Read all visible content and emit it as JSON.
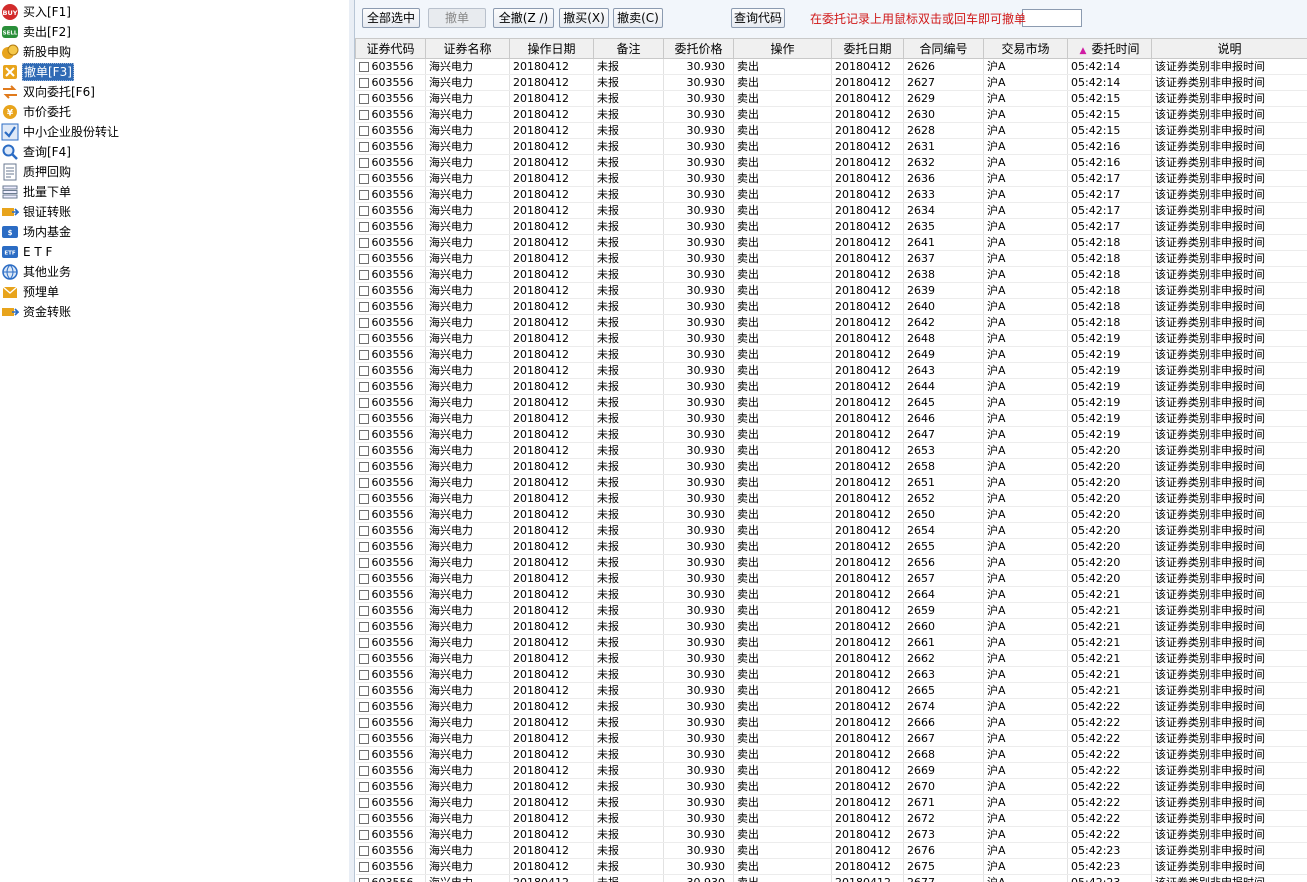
{
  "sidebar": {
    "items": [
      {
        "label": "买入[F1]",
        "icon": "buy-icon",
        "color": "#d22b2b"
      },
      {
        "label": "卖出[F2]",
        "icon": "sell-icon",
        "color": "#2a8f3a"
      },
      {
        "label": "新股申购",
        "icon": "ipo-icon",
        "color": "#e8a41c"
      },
      {
        "label": "撤单[F3]",
        "icon": "cancel-order-icon",
        "color": "#e8a41c"
      },
      {
        "label": "双向委托[F6]",
        "icon": "two-way-order-icon",
        "color": "#e07a1c"
      },
      {
        "label": "市价委托",
        "icon": "market-order-icon",
        "color": "#e8a41c"
      },
      {
        "label": "中小企业股份转让",
        "icon": "checkmark-icon",
        "color": "#2b6cc4"
      },
      {
        "label": "查询[F4]",
        "icon": "magnifier-icon",
        "color": "#2b6cc4"
      },
      {
        "label": "质押回购",
        "icon": "document-icon",
        "color": "#6a7a90"
      },
      {
        "label": "批量下单",
        "icon": "stack-icon",
        "color": "#6a7a90"
      },
      {
        "label": "银证转账",
        "icon": "bank-transfer-icon",
        "color": "#e8a41c"
      },
      {
        "label": "场内基金",
        "icon": "fund-icon",
        "color": "#2b6cc4"
      },
      {
        "label": "E T F",
        "icon": "etf-icon",
        "color": "#2b6cc4"
      },
      {
        "label": "其他业务",
        "icon": "globe-icon",
        "color": "#2b6cc4"
      },
      {
        "label": "预埋单",
        "icon": "preorder-icon",
        "color": "#e8a41c"
      },
      {
        "label": "资金转账",
        "icon": "fund-transfer-icon",
        "color": "#e8a41c"
      }
    ],
    "active_label": "撤单[F3]"
  },
  "toolbar": {
    "select_all_label": "全部选中",
    "cancel_label": "撤单",
    "cancel_all_label": "全撤(Z /)",
    "cancel_buy_label": "撤买(X)",
    "cancel_sell_label": "撤卖(C)",
    "code_input_value": "",
    "query_code_label": "查询代码",
    "hint": "在委托记录上用鼠标双击或回车即可撤单"
  },
  "table": {
    "columns": [
      "证券代码",
      "证券名称",
      "操作日期",
      "备注",
      "委托价格",
      "操作",
      "委托日期",
      "合同编号",
      "交易市场",
      "委托时间",
      "说明"
    ],
    "sorted_column": "委托时间",
    "rows": [
      [
        "603556",
        "海兴电力",
        "20180412",
        "未报",
        "30.930",
        "卖出",
        "20180412",
        "2626",
        "沪A",
        "05:42:14",
        "该证券类别非申报时间"
      ],
      [
        "603556",
        "海兴电力",
        "20180412",
        "未报",
        "30.930",
        "卖出",
        "20180412",
        "2627",
        "沪A",
        "05:42:14",
        "该证券类别非申报时间"
      ],
      [
        "603556",
        "海兴电力",
        "20180412",
        "未报",
        "30.930",
        "卖出",
        "20180412",
        "2629",
        "沪A",
        "05:42:15",
        "该证券类别非申报时间"
      ],
      [
        "603556",
        "海兴电力",
        "20180412",
        "未报",
        "30.930",
        "卖出",
        "20180412",
        "2630",
        "沪A",
        "05:42:15",
        "该证券类别非申报时间"
      ],
      [
        "603556",
        "海兴电力",
        "20180412",
        "未报",
        "30.930",
        "卖出",
        "20180412",
        "2628",
        "沪A",
        "05:42:15",
        "该证券类别非申报时间"
      ],
      [
        "603556",
        "海兴电力",
        "20180412",
        "未报",
        "30.930",
        "卖出",
        "20180412",
        "2631",
        "沪A",
        "05:42:16",
        "该证券类别非申报时间"
      ],
      [
        "603556",
        "海兴电力",
        "20180412",
        "未报",
        "30.930",
        "卖出",
        "20180412",
        "2632",
        "沪A",
        "05:42:16",
        "该证券类别非申报时间"
      ],
      [
        "603556",
        "海兴电力",
        "20180412",
        "未报",
        "30.930",
        "卖出",
        "20180412",
        "2636",
        "沪A",
        "05:42:17",
        "该证券类别非申报时间"
      ],
      [
        "603556",
        "海兴电力",
        "20180412",
        "未报",
        "30.930",
        "卖出",
        "20180412",
        "2633",
        "沪A",
        "05:42:17",
        "该证券类别非申报时间"
      ],
      [
        "603556",
        "海兴电力",
        "20180412",
        "未报",
        "30.930",
        "卖出",
        "20180412",
        "2634",
        "沪A",
        "05:42:17",
        "该证券类别非申报时间"
      ],
      [
        "603556",
        "海兴电力",
        "20180412",
        "未报",
        "30.930",
        "卖出",
        "20180412",
        "2635",
        "沪A",
        "05:42:17",
        "该证券类别非申报时间"
      ],
      [
        "603556",
        "海兴电力",
        "20180412",
        "未报",
        "30.930",
        "卖出",
        "20180412",
        "2641",
        "沪A",
        "05:42:18",
        "该证券类别非申报时间"
      ],
      [
        "603556",
        "海兴电力",
        "20180412",
        "未报",
        "30.930",
        "卖出",
        "20180412",
        "2637",
        "沪A",
        "05:42:18",
        "该证券类别非申报时间"
      ],
      [
        "603556",
        "海兴电力",
        "20180412",
        "未报",
        "30.930",
        "卖出",
        "20180412",
        "2638",
        "沪A",
        "05:42:18",
        "该证券类别非申报时间"
      ],
      [
        "603556",
        "海兴电力",
        "20180412",
        "未报",
        "30.930",
        "卖出",
        "20180412",
        "2639",
        "沪A",
        "05:42:18",
        "该证券类别非申报时间"
      ],
      [
        "603556",
        "海兴电力",
        "20180412",
        "未报",
        "30.930",
        "卖出",
        "20180412",
        "2640",
        "沪A",
        "05:42:18",
        "该证券类别非申报时间"
      ],
      [
        "603556",
        "海兴电力",
        "20180412",
        "未报",
        "30.930",
        "卖出",
        "20180412",
        "2642",
        "沪A",
        "05:42:18",
        "该证券类别非申报时间"
      ],
      [
        "603556",
        "海兴电力",
        "20180412",
        "未报",
        "30.930",
        "卖出",
        "20180412",
        "2648",
        "沪A",
        "05:42:19",
        "该证券类别非申报时间"
      ],
      [
        "603556",
        "海兴电力",
        "20180412",
        "未报",
        "30.930",
        "卖出",
        "20180412",
        "2649",
        "沪A",
        "05:42:19",
        "该证券类别非申报时间"
      ],
      [
        "603556",
        "海兴电力",
        "20180412",
        "未报",
        "30.930",
        "卖出",
        "20180412",
        "2643",
        "沪A",
        "05:42:19",
        "该证券类别非申报时间"
      ],
      [
        "603556",
        "海兴电力",
        "20180412",
        "未报",
        "30.930",
        "卖出",
        "20180412",
        "2644",
        "沪A",
        "05:42:19",
        "该证券类别非申报时间"
      ],
      [
        "603556",
        "海兴电力",
        "20180412",
        "未报",
        "30.930",
        "卖出",
        "20180412",
        "2645",
        "沪A",
        "05:42:19",
        "该证券类别非申报时间"
      ],
      [
        "603556",
        "海兴电力",
        "20180412",
        "未报",
        "30.930",
        "卖出",
        "20180412",
        "2646",
        "沪A",
        "05:42:19",
        "该证券类别非申报时间"
      ],
      [
        "603556",
        "海兴电力",
        "20180412",
        "未报",
        "30.930",
        "卖出",
        "20180412",
        "2647",
        "沪A",
        "05:42:19",
        "该证券类别非申报时间"
      ],
      [
        "603556",
        "海兴电力",
        "20180412",
        "未报",
        "30.930",
        "卖出",
        "20180412",
        "2653",
        "沪A",
        "05:42:20",
        "该证券类别非申报时间"
      ],
      [
        "603556",
        "海兴电力",
        "20180412",
        "未报",
        "30.930",
        "卖出",
        "20180412",
        "2658",
        "沪A",
        "05:42:20",
        "该证券类别非申报时间"
      ],
      [
        "603556",
        "海兴电力",
        "20180412",
        "未报",
        "30.930",
        "卖出",
        "20180412",
        "2651",
        "沪A",
        "05:42:20",
        "该证券类别非申报时间"
      ],
      [
        "603556",
        "海兴电力",
        "20180412",
        "未报",
        "30.930",
        "卖出",
        "20180412",
        "2652",
        "沪A",
        "05:42:20",
        "该证券类别非申报时间"
      ],
      [
        "603556",
        "海兴电力",
        "20180412",
        "未报",
        "30.930",
        "卖出",
        "20180412",
        "2650",
        "沪A",
        "05:42:20",
        "该证券类别非申报时间"
      ],
      [
        "603556",
        "海兴电力",
        "20180412",
        "未报",
        "30.930",
        "卖出",
        "20180412",
        "2654",
        "沪A",
        "05:42:20",
        "该证券类别非申报时间"
      ],
      [
        "603556",
        "海兴电力",
        "20180412",
        "未报",
        "30.930",
        "卖出",
        "20180412",
        "2655",
        "沪A",
        "05:42:20",
        "该证券类别非申报时间"
      ],
      [
        "603556",
        "海兴电力",
        "20180412",
        "未报",
        "30.930",
        "卖出",
        "20180412",
        "2656",
        "沪A",
        "05:42:20",
        "该证券类别非申报时间"
      ],
      [
        "603556",
        "海兴电力",
        "20180412",
        "未报",
        "30.930",
        "卖出",
        "20180412",
        "2657",
        "沪A",
        "05:42:20",
        "该证券类别非申报时间"
      ],
      [
        "603556",
        "海兴电力",
        "20180412",
        "未报",
        "30.930",
        "卖出",
        "20180412",
        "2664",
        "沪A",
        "05:42:21",
        "该证券类别非申报时间"
      ],
      [
        "603556",
        "海兴电力",
        "20180412",
        "未报",
        "30.930",
        "卖出",
        "20180412",
        "2659",
        "沪A",
        "05:42:21",
        "该证券类别非申报时间"
      ],
      [
        "603556",
        "海兴电力",
        "20180412",
        "未报",
        "30.930",
        "卖出",
        "20180412",
        "2660",
        "沪A",
        "05:42:21",
        "该证券类别非申报时间"
      ],
      [
        "603556",
        "海兴电力",
        "20180412",
        "未报",
        "30.930",
        "卖出",
        "20180412",
        "2661",
        "沪A",
        "05:42:21",
        "该证券类别非申报时间"
      ],
      [
        "603556",
        "海兴电力",
        "20180412",
        "未报",
        "30.930",
        "卖出",
        "20180412",
        "2662",
        "沪A",
        "05:42:21",
        "该证券类别非申报时间"
      ],
      [
        "603556",
        "海兴电力",
        "20180412",
        "未报",
        "30.930",
        "卖出",
        "20180412",
        "2663",
        "沪A",
        "05:42:21",
        "该证券类别非申报时间"
      ],
      [
        "603556",
        "海兴电力",
        "20180412",
        "未报",
        "30.930",
        "卖出",
        "20180412",
        "2665",
        "沪A",
        "05:42:21",
        "该证券类别非申报时间"
      ],
      [
        "603556",
        "海兴电力",
        "20180412",
        "未报",
        "30.930",
        "卖出",
        "20180412",
        "2674",
        "沪A",
        "05:42:22",
        "该证券类别非申报时间"
      ],
      [
        "603556",
        "海兴电力",
        "20180412",
        "未报",
        "30.930",
        "卖出",
        "20180412",
        "2666",
        "沪A",
        "05:42:22",
        "该证券类别非申报时间"
      ],
      [
        "603556",
        "海兴电力",
        "20180412",
        "未报",
        "30.930",
        "卖出",
        "20180412",
        "2667",
        "沪A",
        "05:42:22",
        "该证券类别非申报时间"
      ],
      [
        "603556",
        "海兴电力",
        "20180412",
        "未报",
        "30.930",
        "卖出",
        "20180412",
        "2668",
        "沪A",
        "05:42:22",
        "该证券类别非申报时间"
      ],
      [
        "603556",
        "海兴电力",
        "20180412",
        "未报",
        "30.930",
        "卖出",
        "20180412",
        "2669",
        "沪A",
        "05:42:22",
        "该证券类别非申报时间"
      ],
      [
        "603556",
        "海兴电力",
        "20180412",
        "未报",
        "30.930",
        "卖出",
        "20180412",
        "2670",
        "沪A",
        "05:42:22",
        "该证券类别非申报时间"
      ],
      [
        "603556",
        "海兴电力",
        "20180412",
        "未报",
        "30.930",
        "卖出",
        "20180412",
        "2671",
        "沪A",
        "05:42:22",
        "该证券类别非申报时间"
      ],
      [
        "603556",
        "海兴电力",
        "20180412",
        "未报",
        "30.930",
        "卖出",
        "20180412",
        "2672",
        "沪A",
        "05:42:22",
        "该证券类别非申报时间"
      ],
      [
        "603556",
        "海兴电力",
        "20180412",
        "未报",
        "30.930",
        "卖出",
        "20180412",
        "2673",
        "沪A",
        "05:42:22",
        "该证券类别非申报时间"
      ],
      [
        "603556",
        "海兴电力",
        "20180412",
        "未报",
        "30.930",
        "卖出",
        "20180412",
        "2676",
        "沪A",
        "05:42:23",
        "该证券类别非申报时间"
      ],
      [
        "603556",
        "海兴电力",
        "20180412",
        "未报",
        "30.930",
        "卖出",
        "20180412",
        "2675",
        "沪A",
        "05:42:23",
        "该证券类别非申报时间"
      ],
      [
        "603556",
        "海兴电力",
        "20180412",
        "未报",
        "30.930",
        "卖出",
        "20180412",
        "2677",
        "沪A",
        "05:42:23",
        "该证券类别非申报时间"
      ]
    ]
  }
}
